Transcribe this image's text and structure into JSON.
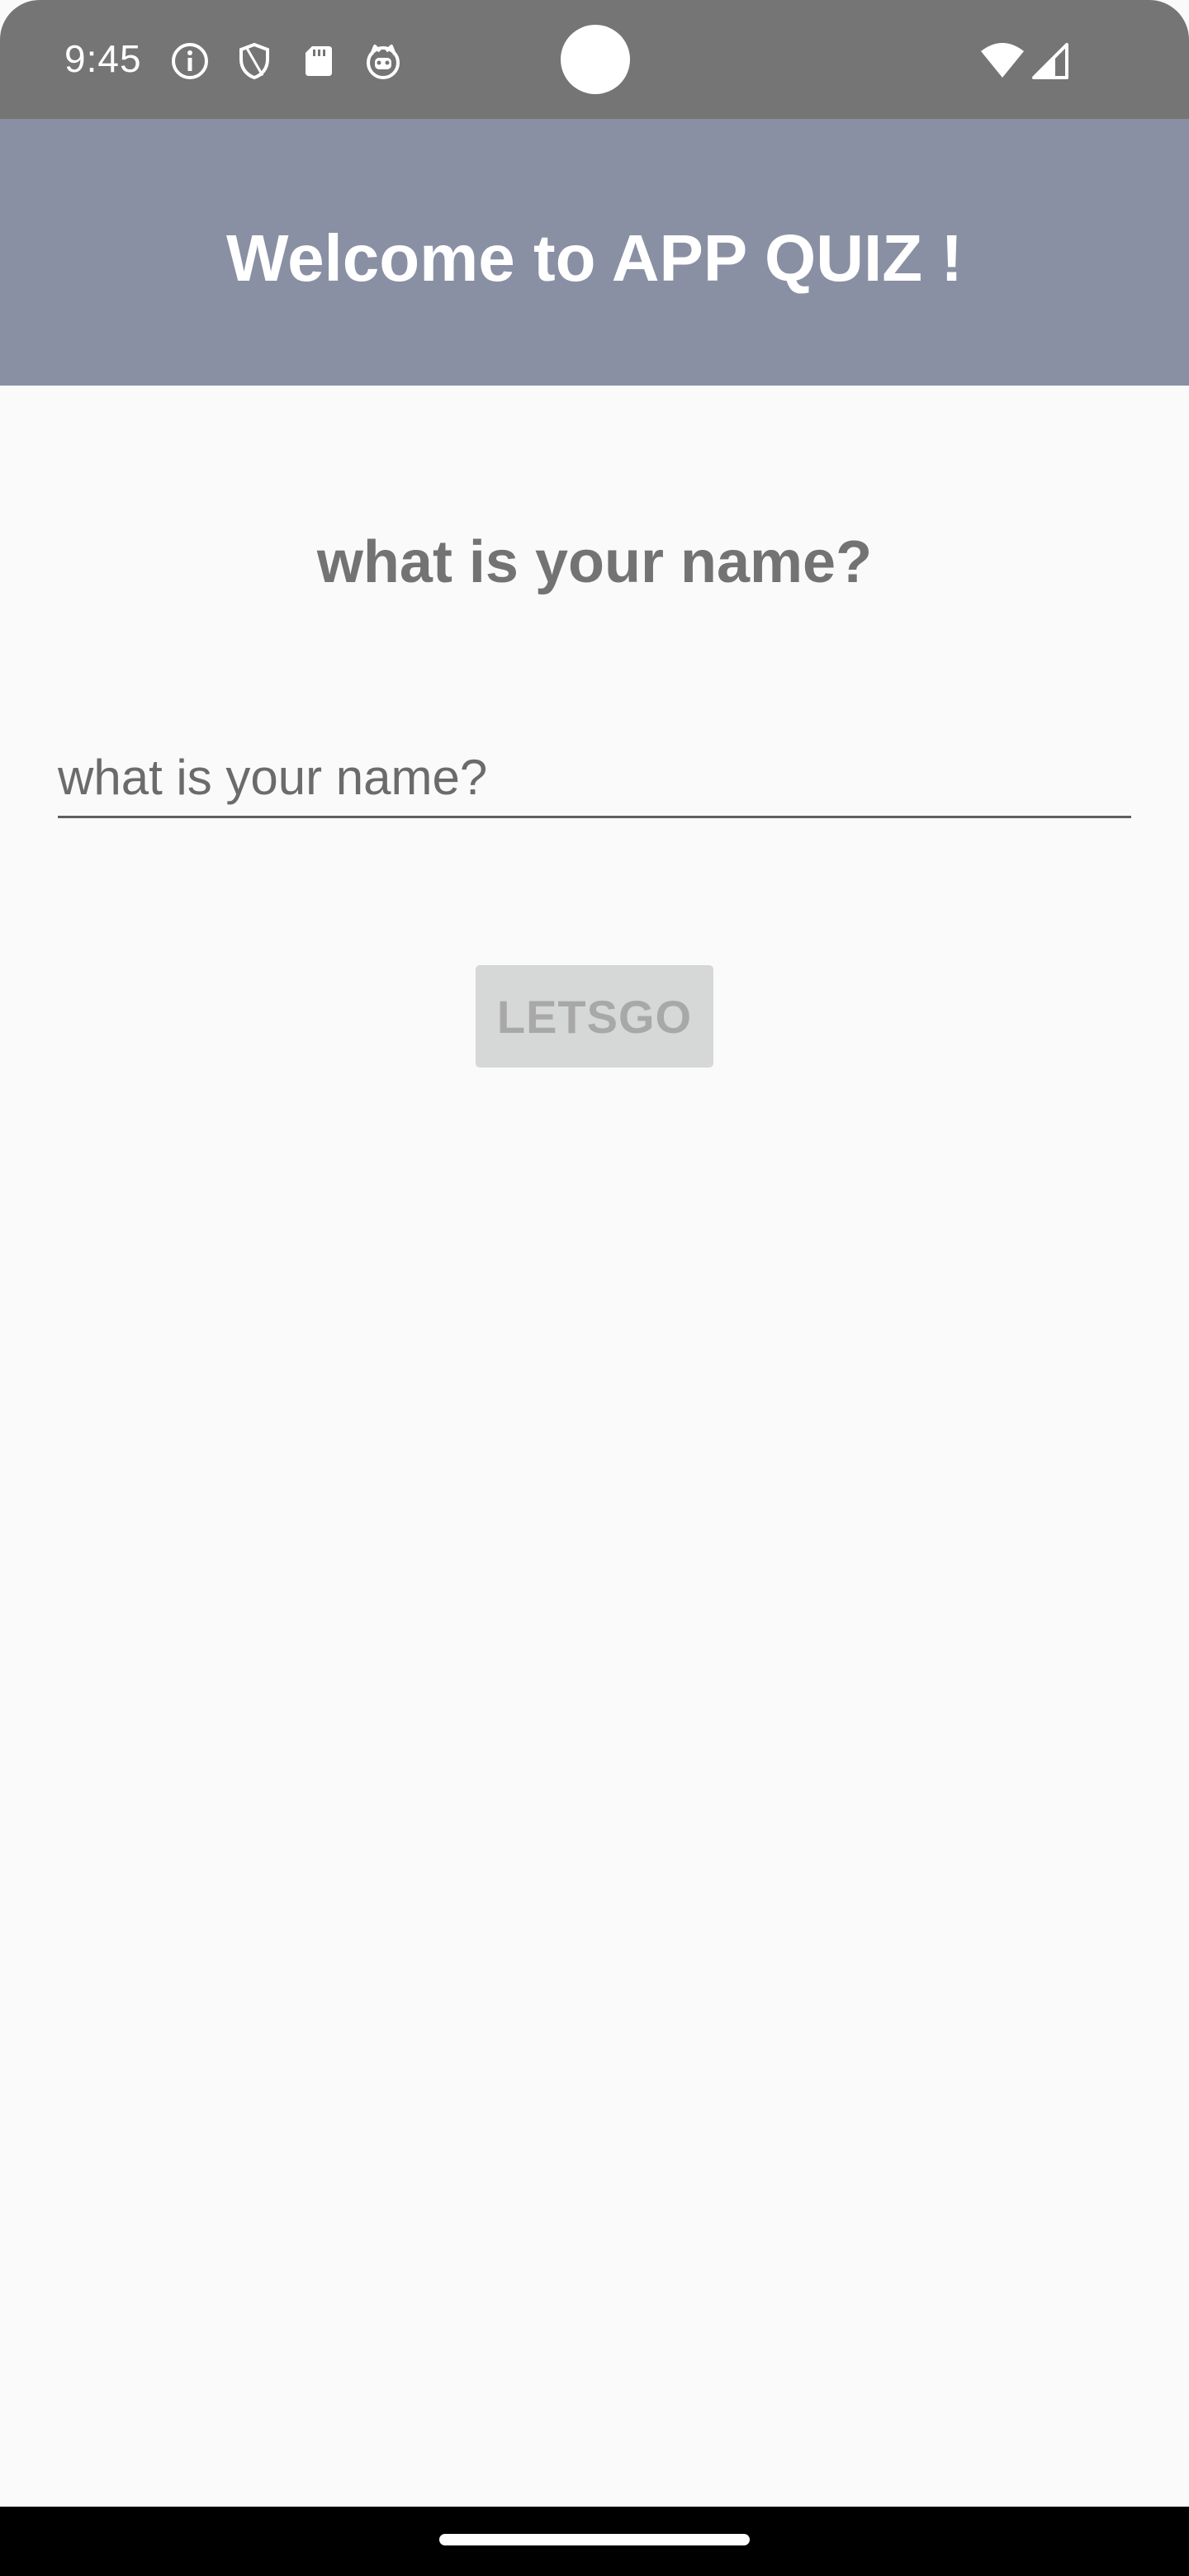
{
  "status_bar": {
    "time": "9:45",
    "icons_left": [
      "info-icon",
      "shield-icon",
      "sd-card-icon",
      "cat-face-icon"
    ],
    "icons_right": [
      "wifi-icon",
      "cell-signal-icon"
    ],
    "background": "#757575"
  },
  "app_bar": {
    "title": "Welcome to APP QUIZ !",
    "background": "#8a90a3"
  },
  "main": {
    "question_title": "what is your name?",
    "name_input": {
      "value": "",
      "placeholder": "what is your name?"
    },
    "letsgo_button": {
      "label": "LETSGO",
      "enabled": false
    }
  },
  "colors": {
    "page_background": "#fafafa",
    "title_text": "#737373",
    "disabled_button_bg": "#d6d7d7",
    "disabled_button_text": "#a8a8a8"
  }
}
